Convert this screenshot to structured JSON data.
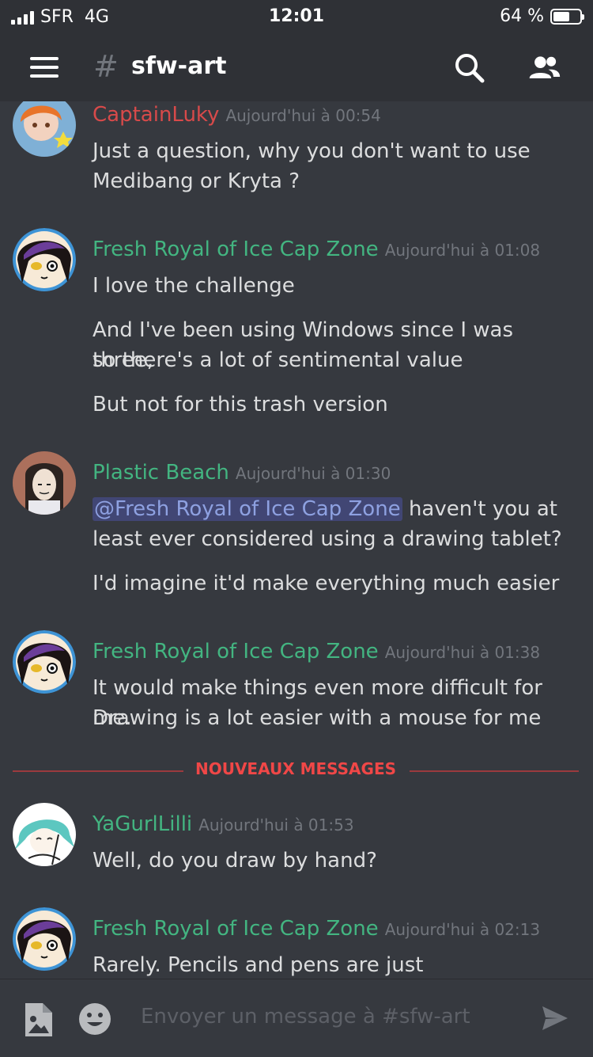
{
  "status_bar": {
    "carrier": "SFR",
    "network": "4G",
    "time": "12:01",
    "battery_text": "64 %",
    "battery_level": 0.64
  },
  "header": {
    "channel_hash": "#",
    "channel_name": "sfw-art"
  },
  "colors": {
    "username_green": "#43b581",
    "username_red": "#d84a4a",
    "divider_red": "#f04747",
    "mention_blue": "#8ea1e1"
  },
  "messages": [
    {
      "author": "CaptainLuky",
      "timestamp": "Aujourd'hui à 00:54",
      "lines": [
        "Just a question, why you don't want to use",
        "Medibang or Kryta ?"
      ]
    },
    {
      "author": "Fresh Royal of Ice Cap Zone",
      "timestamp": "Aujourd'hui à 01:08",
      "lines": [
        "I love the challenge",
        "And I've been using Windows since I was three,",
        "so there's a lot of sentimental value",
        "But not for this trash version"
      ]
    },
    {
      "author": "Plastic Beach",
      "timestamp": "Aujourd'hui à 01:30",
      "mention": "@Fresh Royal of Ice Cap Zone",
      "lines": [
        " haven't you at",
        "least ever considered using a drawing tablet?",
        "I'd imagine it'd make everything much easier"
      ]
    },
    {
      "author": "Fresh Royal of Ice Cap Zone",
      "timestamp": "Aujourd'hui à 01:38",
      "lines": [
        "It would make things even more difficult for me.",
        "Drawing is a lot easier with a mouse for me"
      ]
    },
    {
      "author": "YaGurlLilli",
      "timestamp": "Aujourd'hui à 01:53",
      "lines": [
        "Well, do you draw by hand?"
      ]
    },
    {
      "author": "Fresh Royal of Ice Cap Zone",
      "timestamp": "Aujourd'hui à 02:13",
      "lines": [
        "Rarely. Pencils and pens are just uncomfortable"
      ]
    }
  ],
  "new_messages_divider": "NOUVEAUX MESSAGES",
  "composer": {
    "placeholder": "Envoyer un message à #sfw-art"
  },
  "icons": [
    "menu-icon",
    "search-icon",
    "members-icon",
    "image-icon",
    "emoji-icon",
    "send-icon"
  ]
}
